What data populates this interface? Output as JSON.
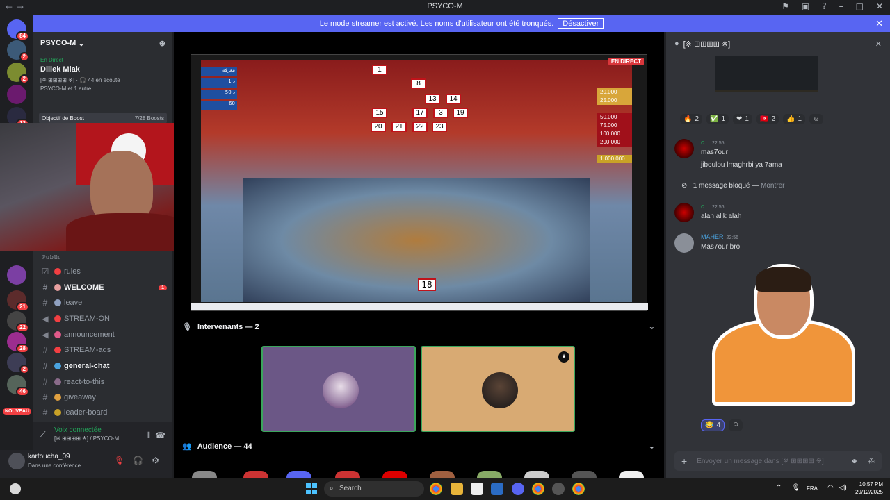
{
  "window": {
    "title": "PSYCO-M"
  },
  "banner": {
    "text": "Le mode streamer est activé. Les noms d'utilisateur ont été tronqués.",
    "button": "Désactiver"
  },
  "server_rail": {
    "badges": [
      "84",
      "2",
      "2",
      "13",
      "21",
      "22",
      "28",
      "2",
      "46"
    ],
    "new_label": "NOUVEAU"
  },
  "sidebar": {
    "server_name": "PSYCO-M",
    "live_label": "En Direct",
    "event_title": "Dlilek Mlak",
    "event_channel": "[※ ⊞⊞⊞⊞ ※]",
    "listeners": "44 en écoute",
    "participants": "PSYCO-M et 1 autre",
    "boost_label": "Objectif de Boost",
    "boost_count": "7/28 Boosts",
    "section": "ℙ𝕦𝕓𝕝𝕚𝕔",
    "channels": [
      {
        "name": "rules",
        "type": "rules"
      },
      {
        "name": "WELCOME",
        "type": "text",
        "mention": "1"
      },
      {
        "name": "leave",
        "type": "text"
      },
      {
        "name": "STREAM-ON",
        "type": "announce"
      },
      {
        "name": "announcement",
        "type": "announce"
      },
      {
        "name": "STREAM-ads",
        "type": "text"
      },
      {
        "name": "general-chat",
        "type": "text"
      },
      {
        "name": "react-to-this",
        "type": "text"
      },
      {
        "name": "giveaway",
        "type": "text"
      },
      {
        "name": "leader-board",
        "type": "text"
      }
    ]
  },
  "voice": {
    "status": "Voix connectée",
    "channel": "[※ ⊞⊞⊞⊞ ※] / PSYCO-M"
  },
  "user": {
    "name": "kartoucha_09",
    "status": "Dans une conférence"
  },
  "stage": {
    "live_tag": "EN DIRECT",
    "boxes": [
      "1",
      "8",
      "13",
      "14",
      "15",
      "17",
      "3",
      "19",
      "20",
      "21",
      "22",
      "23"
    ],
    "box_bottom": "18",
    "prizes": [
      "20.000",
      "25.000",
      "50.000",
      "75.000",
      "100.000",
      "200.000",
      "1.000.000"
    ],
    "left_labels": [
      "معرفة",
      "1 د",
      "50 د",
      "60"
    ],
    "speakers_title": "Intervenants — 2",
    "audience_title": "Audience — 44",
    "colors": {
      "speaker1": "#6b5786",
      "speaker2": "#d8aa73",
      "speaking_border": "#3ba55c"
    }
  },
  "chat": {
    "title": "[※ ⊞⊞⊞⊞ ※]",
    "reactions": [
      {
        "emoji": "🔥",
        "count": "2"
      },
      {
        "emoji": "✅",
        "count": "1"
      },
      {
        "emoji": "❤",
        "count": "1"
      },
      {
        "emoji": "🇹🇳",
        "count": "2"
      },
      {
        "emoji": "👍",
        "count": "1"
      }
    ],
    "messages": [
      {
        "author": "c...",
        "time": "22:55",
        "lines": [
          "mas7our",
          "jiboulou lmaghrbi ya 7ama"
        ]
      },
      {
        "author": "c...",
        "time": "22:56",
        "lines": [
          "alah alik alah"
        ]
      },
      {
        "author": "MAHER",
        "time": "22:56",
        "lines": [
          "Mas7our bro"
        ]
      }
    ],
    "blocked": {
      "text": "1 message bloqué —",
      "action": "Montrer"
    },
    "sticker_reaction": {
      "emoji": "😂",
      "count": "4"
    },
    "compose_placeholder": "Envoyer un message dans [※ ⊞⊞⊞⊞ ※]"
  },
  "taskbar": {
    "search": "Search",
    "lang": "FRA",
    "time": "10:57 PM",
    "date": "29/12/2025"
  }
}
